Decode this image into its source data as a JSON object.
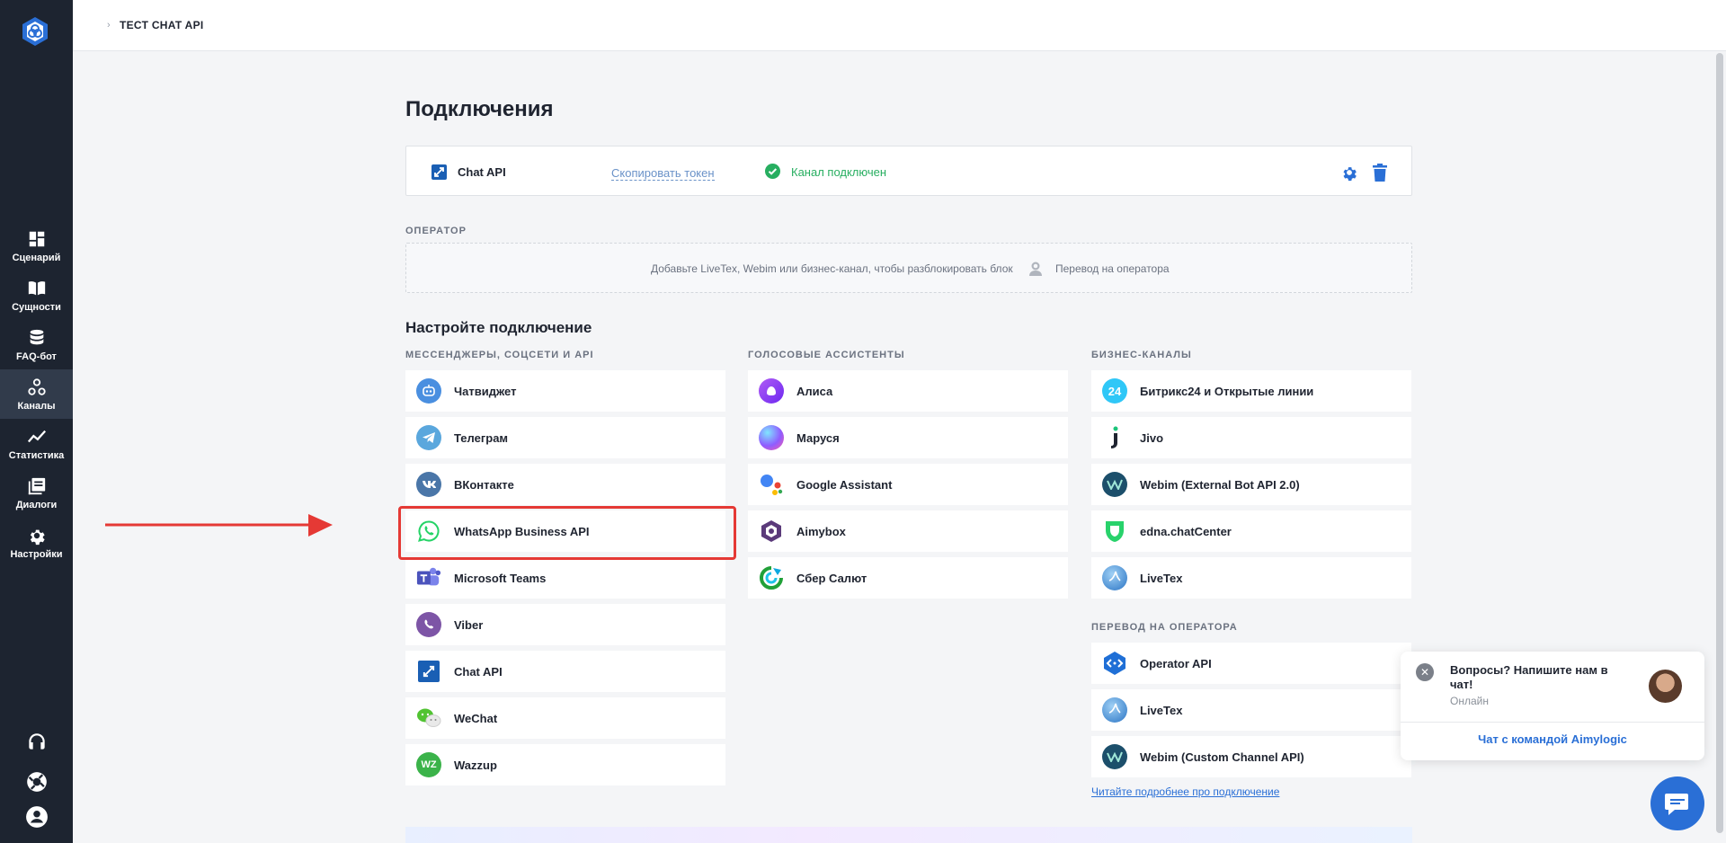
{
  "breadcrumb": {
    "text": "ТЕСТ CHAT API"
  },
  "sidebar": {
    "items": [
      {
        "label": "Сценарий",
        "icon": "dashboard-icon"
      },
      {
        "label": "Сущности",
        "icon": "book-icon"
      },
      {
        "label": "FAQ-бот",
        "icon": "database-icon"
      },
      {
        "label": "Каналы",
        "icon": "channels-icon",
        "active": true
      },
      {
        "label": "Статистика",
        "icon": "chart-line-icon"
      },
      {
        "label": "Диалоги",
        "icon": "dialogs-icon"
      },
      {
        "label": "Настройки",
        "icon": "gear-icon"
      }
    ],
    "bottom_icons": [
      "headset-icon",
      "lifebuoy-icon",
      "user-icon"
    ]
  },
  "page": {
    "title": "Подключения"
  },
  "connection": {
    "name": "Chat API",
    "copy_token": "Скопировать токен",
    "status": "Канал подключен",
    "status_color": "#27ae60"
  },
  "operator": {
    "caption": "ОПЕРАТОР",
    "hint": "Добавьте LiveTex, Webim или бизнес-канал, чтобы разблокировать блок",
    "label": "Перевод на оператора"
  },
  "setup": {
    "title": "Настройте подключение",
    "messengers": {
      "caption": "МЕССЕНДЖЕРЫ, СОЦСЕТИ И API",
      "items": [
        "Чатвиджет",
        "Телеграм",
        "ВКонтакте",
        "WhatsApp Business API",
        "Microsoft Teams",
        "Viber",
        "Chat API",
        "WeChat",
        "Wazzup"
      ]
    },
    "voice": {
      "caption": "ГОЛОСОВЫЕ АССИСТЕНТЫ",
      "items": [
        "Алиса",
        "Маруся",
        "Google Assistant",
        "Aimybox",
        "Сбер Салют"
      ]
    },
    "business": {
      "caption": "БИЗНЕС-КАНАЛЫ",
      "items": [
        "Битрикс24 и Открытые линии",
        "Jivo",
        "Webim (External Bot API 2.0)",
        "edna.chatCenter",
        "LiveTex"
      ]
    },
    "transfer": {
      "caption": "ПЕРЕВОД НА ОПЕРАТОРА",
      "items": [
        "Operator API",
        "LiveTex",
        "Webim (Custom Channel API)"
      ]
    },
    "read_more": "Читайте подробнее про подключение"
  },
  "chat_widget": {
    "question": "Вопросы? Напишите нам в чат!",
    "online": "Онлайн",
    "team": "Чат с командой Aimylogic"
  },
  "icons": {
    "wazzup_text": "WZ",
    "bitrix_text": "24"
  },
  "colors": {
    "accent": "#2a6fd6",
    "sidebar": "#1d2430",
    "highlight": "#e53935"
  }
}
